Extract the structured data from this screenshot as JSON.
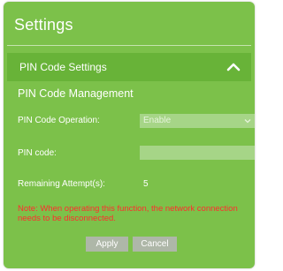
{
  "dialog": {
    "title": "Settings"
  },
  "section": {
    "label": "PIN Code Settings",
    "icon": "chevron-up-icon"
  },
  "subheading": "PIN Code Management",
  "form": {
    "operation_label": "PIN Code Operation:",
    "operation_value": "Enable",
    "pin_label": "PIN code:",
    "pin_value": "",
    "attempts_label": "Remaining Attempt(s):",
    "attempts_value": "5"
  },
  "note": "Note: When operating this function, the network connection needs to be disconnected.",
  "buttons": {
    "apply": "Apply",
    "cancel": "Cancel"
  },
  "colors": {
    "panel": "#7cc14a",
    "section_bar": "#68b338",
    "note": "#ff2d2d",
    "button": "#aeb7a8"
  }
}
